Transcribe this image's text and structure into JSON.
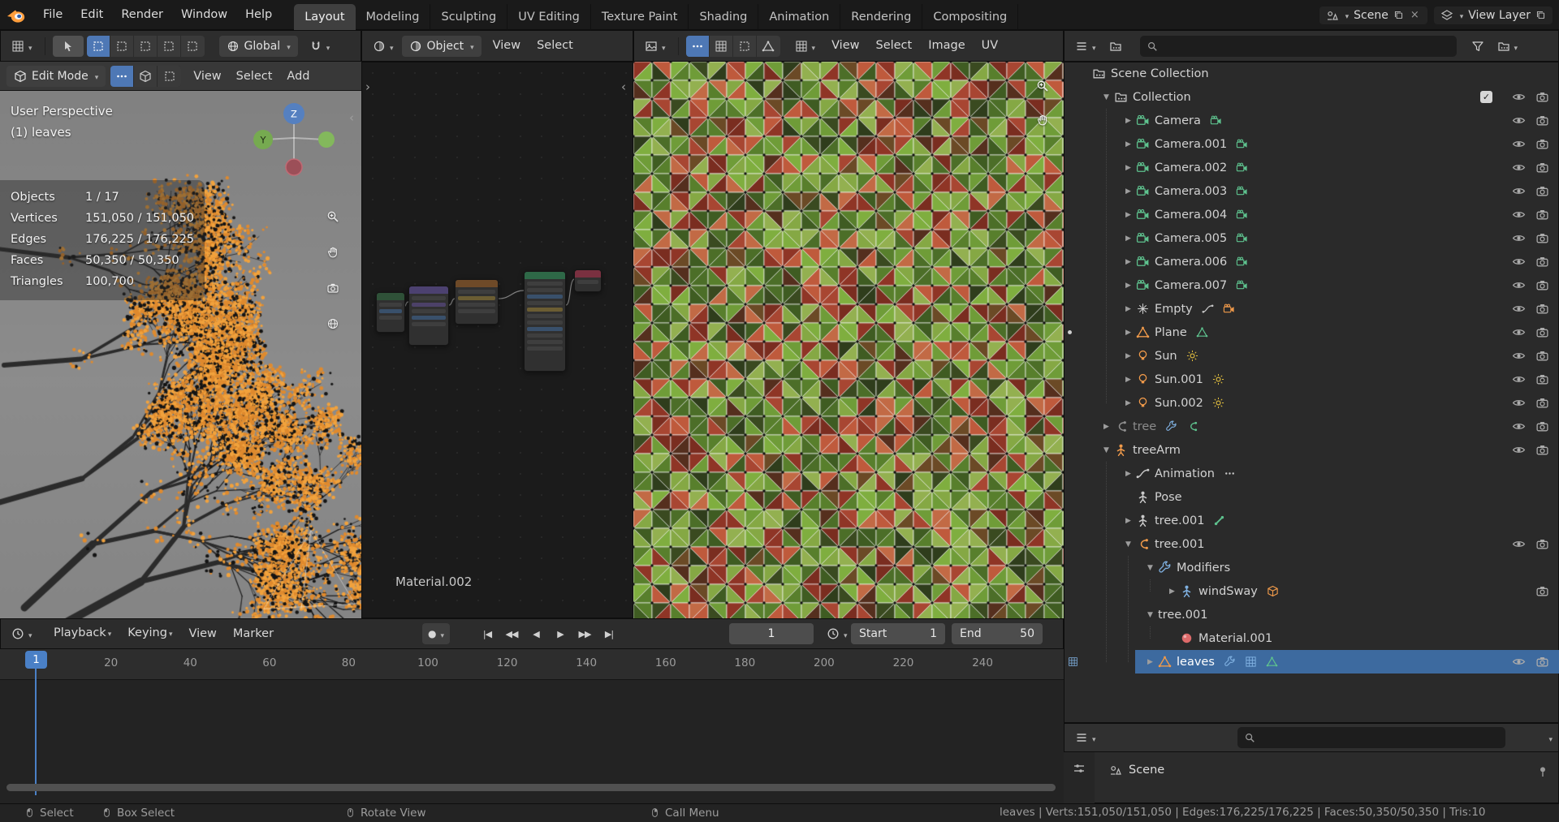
{
  "topbar": {
    "menus": [
      {
        "label": "File"
      },
      {
        "label": "Edit"
      },
      {
        "label": "Render"
      },
      {
        "label": "Window"
      },
      {
        "label": "Help"
      }
    ],
    "workspaces": [
      {
        "label": "Layout",
        "active": true
      },
      {
        "label": "Modeling"
      },
      {
        "label": "Sculpting"
      },
      {
        "label": "UV Editing"
      },
      {
        "label": "Texture Paint"
      },
      {
        "label": "Shading"
      },
      {
        "label": "Animation"
      },
      {
        "label": "Rendering"
      },
      {
        "label": "Compositing"
      }
    ],
    "scene": {
      "label": "Scene"
    },
    "view_layer": {
      "label": "View Layer"
    }
  },
  "tool_header": {
    "orientation_label": "Global"
  },
  "viewport": {
    "mode_label": "Edit Mode",
    "menus": [
      {
        "label": "View"
      },
      {
        "label": "Select"
      },
      {
        "label": "Add"
      }
    ],
    "overlay_title": "User Perspective",
    "overlay_subtitle": "(1) leaves",
    "stats": [
      {
        "label": "Objects",
        "value": "1 / 17"
      },
      {
        "label": "Vertices",
        "value": "151,050 / 151,050"
      },
      {
        "label": "Edges",
        "value": "176,225 / 176,225"
      },
      {
        "label": "Faces",
        "value": "50,350 / 50,350"
      },
      {
        "label": "Triangles",
        "value": "100,700"
      }
    ],
    "gizmo_axes": {
      "z": "Z",
      "y": "Y"
    }
  },
  "shader_editor": {
    "type_label": "Object",
    "menus": [
      {
        "label": "View"
      },
      {
        "label": "Select"
      }
    ],
    "material_name": "Material.002"
  },
  "uv_editor": {
    "menus": [
      {
        "label": "View"
      },
      {
        "label": "Select"
      },
      {
        "label": "Image"
      },
      {
        "label": "UV"
      }
    ]
  },
  "outliner": {
    "rows": [
      {
        "label": "Scene Collection",
        "indent": 0,
        "icon": "collection",
        "icolor": "gray"
      },
      {
        "label": "Collection",
        "indent": 1,
        "disc": "open",
        "icon": "collection",
        "icolor": "gray",
        "checkbox": true,
        "eye": true,
        "cam": true
      },
      {
        "label": "Camera",
        "indent": 2,
        "disc": "closed",
        "icon": "vcam",
        "icolor": "green",
        "badges": [
          {
            "icon": "vcam",
            "color": "green"
          }
        ],
        "eye": true,
        "cam": true
      },
      {
        "label": "Camera.001",
        "indent": 2,
        "disc": "closed",
        "icon": "vcam",
        "icolor": "green",
        "badges": [
          {
            "icon": "vcam",
            "color": "green"
          }
        ],
        "eye": true,
        "cam": true
      },
      {
        "label": "Camera.002",
        "indent": 2,
        "disc": "closed",
        "icon": "vcam",
        "icolor": "green",
        "badges": [
          {
            "icon": "vcam",
            "color": "green"
          }
        ],
        "eye": true,
        "cam": true
      },
      {
        "label": "Camera.003",
        "indent": 2,
        "disc": "closed",
        "icon": "vcam",
        "icolor": "green",
        "badges": [
          {
            "icon": "vcam",
            "color": "green"
          }
        ],
        "eye": true,
        "cam": true
      },
      {
        "label": "Camera.004",
        "indent": 2,
        "disc": "closed",
        "icon": "vcam",
        "icolor": "green",
        "badges": [
          {
            "icon": "vcam",
            "color": "green"
          }
        ],
        "eye": true,
        "cam": true
      },
      {
        "label": "Camera.005",
        "indent": 2,
        "disc": "closed",
        "icon": "vcam",
        "icolor": "green",
        "badges": [
          {
            "icon": "vcam",
            "color": "green"
          }
        ],
        "eye": true,
        "cam": true
      },
      {
        "label": "Camera.006",
        "indent": 2,
        "disc": "closed",
        "icon": "vcam",
        "icolor": "green",
        "badges": [
          {
            "icon": "vcam",
            "color": "green"
          }
        ],
        "eye": true,
        "cam": true
      },
      {
        "label": "Camera.007",
        "indent": 2,
        "disc": "closed",
        "icon": "vcam",
        "icolor": "green",
        "badges": [
          {
            "icon": "vcam",
            "color": "green"
          }
        ],
        "eye": true,
        "cam": true
      },
      {
        "label": "Empty",
        "indent": 2,
        "disc": "closed",
        "icon": "empty",
        "icolor": "gray",
        "badges": [
          {
            "icon": "fcurve",
            "color": "gray"
          },
          {
            "icon": "vcam",
            "color": "orange"
          }
        ],
        "eye": true,
        "cam": true
      },
      {
        "label": "Plane",
        "indent": 2,
        "disc": "closed",
        "icon": "tri",
        "icolor": "orange",
        "badges": [
          {
            "icon": "tri",
            "color": "green"
          }
        ],
        "eye": true,
        "cam": true,
        "margin": "dot"
      },
      {
        "label": "Sun",
        "indent": 2,
        "disc": "closed",
        "icon": "bulb",
        "icolor": "orange",
        "badges": [
          {
            "icon": "sun",
            "color": "yellow"
          }
        ],
        "eye": true,
        "cam": true
      },
      {
        "label": "Sun.001",
        "indent": 2,
        "disc": "closed",
        "icon": "bulb",
        "icolor": "orange",
        "badges": [
          {
            "icon": "sun",
            "color": "yellow"
          }
        ],
        "eye": true,
        "cam": true
      },
      {
        "label": "Sun.002",
        "indent": 2,
        "disc": "closed",
        "icon": "bulb",
        "icolor": "orange",
        "badges": [
          {
            "icon": "sun",
            "color": "yellow"
          }
        ],
        "eye": true,
        "cam": true
      },
      {
        "label": "tree",
        "indent": 1,
        "disc": "closed",
        "icon": "curve",
        "icolor": "dim",
        "dim": true,
        "badges": [
          {
            "icon": "wrench",
            "color": "blue"
          },
          {
            "icon": "curve",
            "color": "green"
          }
        ],
        "eye": true,
        "cam": true
      },
      {
        "label": "treeArm",
        "indent": 1,
        "disc": "open",
        "icon": "person",
        "icolor": "orange",
        "eye": true,
        "cam": true
      },
      {
        "label": "Animation",
        "indent": 2,
        "disc": "closed",
        "icon": "fcurve",
        "icolor": "gray",
        "badges": [
          {
            "icon": "dots",
            "color": "gray"
          }
        ]
      },
      {
        "label": "Pose",
        "indent": 2,
        "icon": "person",
        "icolor": "gray"
      },
      {
        "label": "tree.001",
        "indent": 2,
        "disc": "closed",
        "icon": "person",
        "icolor": "gray",
        "badges": [
          {
            "icon": "bone",
            "color": "green"
          }
        ]
      },
      {
        "label": "tree.001",
        "indent": 2,
        "disc": "open",
        "icon": "curve",
        "icolor": "orange",
        "eye": true,
        "cam": true
      },
      {
        "label": "Modifiers",
        "indent": 3,
        "disc": "open",
        "icon": "wrench",
        "icolor": "blue"
      },
      {
        "label": "windSway",
        "indent": 4,
        "disc": "closed",
        "icon": "person",
        "icolor": "blue",
        "badges": [
          {
            "icon": "cube",
            "color": "orange"
          }
        ],
        "cam": true
      },
      {
        "label": "tree.001",
        "indent": 3,
        "disc": "open"
      },
      {
        "label": "Material.001",
        "indent": 4,
        "icon": "sphere",
        "icolor": "red"
      },
      {
        "label": "leaves",
        "indent": 3,
        "disc": "closed",
        "icon": "tri",
        "icolor": "orange",
        "selected": true,
        "badges": [
          {
            "icon": "wrench",
            "color": "blue"
          },
          {
            "icon": "grid",
            "color": "blue"
          },
          {
            "icon": "tri",
            "color": "green"
          }
        ],
        "eye": true,
        "cam": true,
        "margin": "cube"
      }
    ]
  },
  "timeline": {
    "menus": [
      {
        "label": "Playback",
        "arrow": true
      },
      {
        "label": "Keying",
        "arrow": true
      },
      {
        "label": "View"
      },
      {
        "label": "Marker"
      }
    ],
    "transport": [
      {
        "name": "jump-to-start",
        "glyph": "|◀"
      },
      {
        "name": "jump-to-prev-keyframe",
        "glyph": "◀◀"
      },
      {
        "name": "play-reverse",
        "glyph": "◀"
      },
      {
        "name": "play",
        "glyph": "▶"
      },
      {
        "name": "jump-to-next-keyframe",
        "glyph": "▶▶"
      },
      {
        "name": "jump-to-end",
        "glyph": "▶|"
      }
    ],
    "record_glyph": "●",
    "current_frame": "1",
    "start_label": "Start",
    "start_value": "1",
    "end_label": "End",
    "end_value": "50",
    "ticks": [
      20,
      40,
      60,
      80,
      100,
      120,
      140,
      160,
      180,
      200,
      220,
      240
    ]
  },
  "properties": {
    "scene_row_label": "Scene"
  },
  "statusbar": {
    "hints": [
      {
        "label": "Select"
      },
      {
        "label": "Box Select"
      },
      {
        "label": "Rotate View"
      },
      {
        "label": "Call Menu"
      }
    ],
    "stats": "leaves | Verts:151,050/151,050 | Edges:176,225/176,225 | Faces:50,350/50,350 | Tris:10"
  }
}
